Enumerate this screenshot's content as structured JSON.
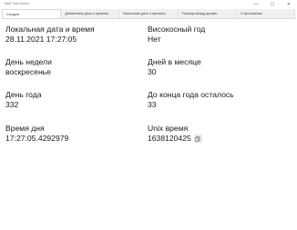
{
  "window": {
    "title": "Date Time Select",
    "minimize_glyph": "—",
    "maximize_glyph": "☐",
    "close_glyph": "✕"
  },
  "tabs": [
    {
      "label": "Сегодня"
    },
    {
      "label": "Добавление даты и времени"
    },
    {
      "label": "Вычитание даты и времени"
    },
    {
      "label": "Разница между датами"
    },
    {
      "label": "О приложении"
    }
  ],
  "today": {
    "local_datetime": {
      "label": "Локальная дата и время",
      "value": "28.11.2021 17:27:05"
    },
    "leap_year": {
      "label": "Високосный год",
      "value": "Нет"
    },
    "weekday": {
      "label": "День недели",
      "value": "воскресенье"
    },
    "days_in_month": {
      "label": "Дней в месяце",
      "value": "30"
    },
    "day_of_year": {
      "label": "День года",
      "value": "332"
    },
    "days_left": {
      "label": "До конца года осталось",
      "value": "33"
    },
    "time_of_day": {
      "label": "Время дня",
      "value": "17:27:05.4292979"
    },
    "unix_time": {
      "label": "Unix время",
      "value": "1638120425"
    }
  },
  "icons": {
    "copy": "copy-icon"
  }
}
